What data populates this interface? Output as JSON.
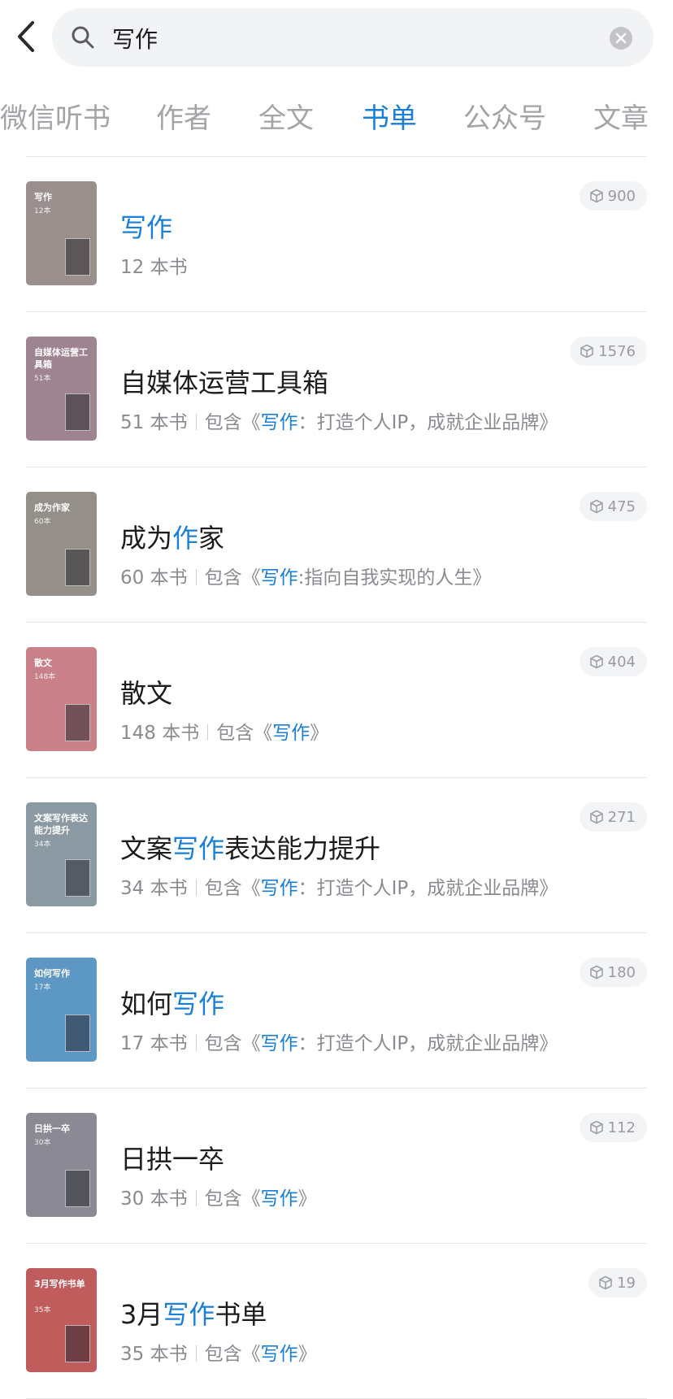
{
  "search": {
    "query": "写作"
  },
  "tabs": [
    {
      "label": "微信听书",
      "active": false
    },
    {
      "label": "作者",
      "active": false
    },
    {
      "label": "全文",
      "active": false
    },
    {
      "label": "书单",
      "active": true
    },
    {
      "label": "公众号",
      "active": false
    },
    {
      "label": "文章",
      "active": false
    }
  ],
  "colors": {
    "accent": "#1a7fd6",
    "muted": "#8a8b90"
  },
  "booklists": [
    {
      "title_parts": [
        {
          "text": "写作",
          "hl": true
        }
      ],
      "count": "12 本书",
      "contains": [],
      "badge": "900",
      "cover": {
        "title": "写作",
        "count": "12本",
        "color": "#9b8f8e"
      }
    },
    {
      "title_parts": [
        {
          "text": "自媒体运营工具箱",
          "hl": false
        }
      ],
      "count": "51 本书",
      "contains": [
        {
          "text": "包含《",
          "hl": false
        },
        {
          "text": "写作",
          "hl": true
        },
        {
          "text": "：打造个人IP，成就企业品牌》",
          "hl": false
        }
      ],
      "badge": "1576",
      "cover": {
        "title": "自媒体运营工具箱",
        "count": "51本",
        "color": "#9e8490"
      }
    },
    {
      "title_parts": [
        {
          "text": "成为",
          "hl": false
        },
        {
          "text": "作",
          "hl": true
        },
        {
          "text": "家",
          "hl": false
        }
      ],
      "count": "60 本书",
      "contains": [
        {
          "text": "包含《",
          "hl": false
        },
        {
          "text": "写作",
          "hl": true
        },
        {
          "text": ":指向自我实现的人生》",
          "hl": false
        }
      ],
      "badge": "475",
      "cover": {
        "title": "成为作家",
        "count": "60本",
        "color": "#958f89"
      }
    },
    {
      "title_parts": [
        {
          "text": "散文",
          "hl": false
        }
      ],
      "count": "148 本书",
      "contains": [
        {
          "text": "包含《",
          "hl": false
        },
        {
          "text": "写作",
          "hl": true
        },
        {
          "text": "》",
          "hl": false
        }
      ],
      "badge": "404",
      "cover": {
        "title": "散文",
        "count": "148本",
        "color": "#c98088"
      }
    },
    {
      "title_parts": [
        {
          "text": "文案",
          "hl": false
        },
        {
          "text": "写作",
          "hl": true
        },
        {
          "text": "表达能力提升",
          "hl": false
        }
      ],
      "count": "34 本书",
      "contains": [
        {
          "text": "包含《",
          "hl": false
        },
        {
          "text": "写作",
          "hl": true
        },
        {
          "text": "：打造个人IP，成就企业品牌》",
          "hl": false
        }
      ],
      "badge": "271",
      "cover": {
        "title": "文案写作表达能力提升",
        "count": "34本",
        "color": "#8b9aa2"
      }
    },
    {
      "title_parts": [
        {
          "text": "如何",
          "hl": false
        },
        {
          "text": "写作",
          "hl": true
        }
      ],
      "count": "17 本书",
      "contains": [
        {
          "text": "包含《",
          "hl": false
        },
        {
          "text": "写作",
          "hl": true
        },
        {
          "text": "：打造个人IP，成就企业品牌》",
          "hl": false
        }
      ],
      "badge": "180",
      "cover": {
        "title": "如何写作",
        "count": "17本",
        "color": "#5d98c4"
      }
    },
    {
      "title_parts": [
        {
          "text": "日拱一卒",
          "hl": false
        }
      ],
      "count": "30 本书",
      "contains": [
        {
          "text": "包含《",
          "hl": false
        },
        {
          "text": "写作",
          "hl": true
        },
        {
          "text": "》",
          "hl": false
        }
      ],
      "badge": "112",
      "cover": {
        "title": "日拱一卒",
        "count": "30本",
        "color": "#8a8994"
      }
    },
    {
      "title_parts": [
        {
          "text": "3月",
          "hl": false
        },
        {
          "text": "写作",
          "hl": true
        },
        {
          "text": "书单",
          "hl": false
        }
      ],
      "count": "35 本书",
      "contains": [
        {
          "text": "包含《",
          "hl": false
        },
        {
          "text": "写作",
          "hl": true
        },
        {
          "text": "》",
          "hl": false
        }
      ],
      "badge": "19",
      "cover": {
        "title": "3月写作书单",
        "count": "35本",
        "color": "#c05c5c"
      }
    }
  ]
}
